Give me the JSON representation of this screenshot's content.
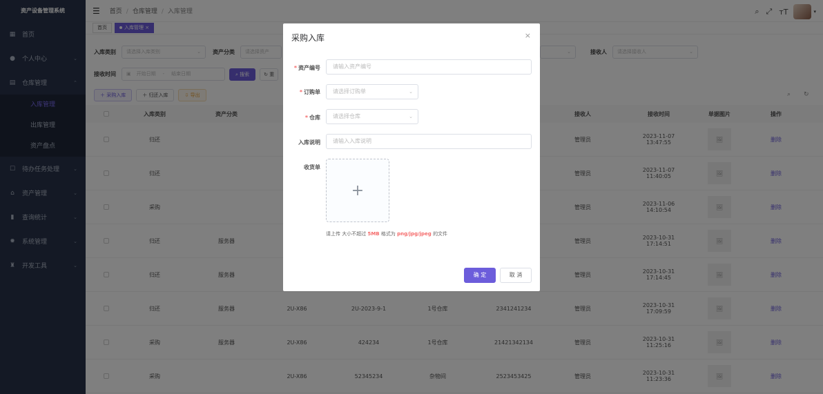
{
  "sidebar": {
    "logo": "资产设备管理系统",
    "items": [
      {
        "label": "首页",
        "icon": "dashboard-icon"
      },
      {
        "label": "个人中心",
        "icon": "user-icon"
      },
      {
        "label": "仓库管理",
        "icon": "grid-icon"
      }
    ],
    "sub_items": [
      "入库管理",
      "出库管理",
      "资产盘点"
    ],
    "items_after": [
      {
        "label": "待办任务处理",
        "icon": "task-icon"
      },
      {
        "label": "资产管理",
        "icon": "home-icon"
      },
      {
        "label": "查询统计",
        "icon": "bar-chart-icon"
      },
      {
        "label": "系统管理",
        "icon": "gear-icon"
      },
      {
        "label": "开发工具",
        "icon": "tool-icon"
      }
    ]
  },
  "navbar": {
    "breadcrumb": [
      "首页",
      "仓库管理",
      "入库管理"
    ],
    "sep": "/"
  },
  "tags": {
    "home": "首页",
    "active": "入库管理",
    "close": "×"
  },
  "filters": {
    "in_type_label": "入库类别",
    "in_type_placeholder": "请选择入库类别",
    "asset_cat_label": "资产分类",
    "asset_cat_placeholder": "请选择资产",
    "receiver_label": "接收人",
    "receiver_placeholder": "请选择接收人",
    "recv_time_label": "接收时间",
    "start_placeholder": "开始日期",
    "dash": "-",
    "end_placeholder": "结束日期",
    "search_btn": "搜索",
    "reset_btn": "重"
  },
  "toolbar": {
    "purchase_in": "采购入库",
    "return_in": "归还入库",
    "export": "导出"
  },
  "table": {
    "headers": {
      "type": "入库类别",
      "cat": "资产分类",
      "receiver": "接收人",
      "time": "接收时间",
      "image": "单据图片",
      "ops": "操作"
    },
    "delete_label": "删除",
    "rows": [
      {
        "type": "归还",
        "cat": "",
        "model": "",
        "code": "",
        "wh": "",
        "order": "",
        "receiver": "管理员",
        "time": "2023-11-07 13:47:55"
      },
      {
        "type": "归还",
        "cat": "",
        "model": "",
        "code": "",
        "wh": "",
        "order": "",
        "receiver": "管理员",
        "time": "2023-11-07 11:40:05"
      },
      {
        "type": "采购",
        "cat": "",
        "model": "",
        "code": "",
        "wh": "",
        "order": "",
        "receiver": "管理员",
        "time": "2023-11-06 14:10:54"
      },
      {
        "type": "归还",
        "cat": "服务器",
        "model": "",
        "code": "",
        "wh": "",
        "order": "",
        "receiver": "管理员",
        "time": "2023-10-31 17:14:51"
      },
      {
        "type": "归还",
        "cat": "服务器",
        "model": "",
        "code": "",
        "wh": "",
        "order": "",
        "receiver": "管理员",
        "time": "2023-10-31 17:14:45"
      },
      {
        "type": "归还",
        "cat": "服务器",
        "model": "2U-X86",
        "code": "2U-2023-9-1",
        "wh": "1号仓库",
        "order": "2341241234",
        "receiver": "管理员",
        "time": "2023-10-31 17:09:59"
      },
      {
        "type": "采购",
        "cat": "服务器",
        "model": "2U-X86",
        "code": "424234",
        "wh": "1号仓库",
        "order": "21421342134",
        "receiver": "管理员",
        "time": "2023-10-31 11:25:16"
      },
      {
        "type": "采购",
        "cat": "",
        "model": "2U-X86",
        "code": "52345234",
        "wh": "杂物间",
        "order": "2523453425",
        "receiver": "管理员",
        "time": "2023-10-31 11:23:36"
      }
    ]
  },
  "modal": {
    "title": "采购入库",
    "close": "×",
    "required_mark": "*",
    "asset_no_label": "资产编号",
    "asset_no_placeholder": "请输入资产编号",
    "order_label": "订购单",
    "order_placeholder": "请选择订购单",
    "wh_label": "仓库",
    "wh_placeholder": "请选择仓库",
    "desc_label": "入库说明",
    "desc_placeholder": "请输入入库说明",
    "receipt_label": "收货单",
    "upload_plus": "+",
    "tip_prefix": "请上传 大小不超过",
    "tip_size": "5MB",
    "tip_mid": "格式为",
    "tip_formats": "png/jpg/jpeg",
    "tip_suffix": "的文件",
    "confirm": "确 定",
    "cancel": "取 消"
  },
  "colors": {
    "accent": "#6c5ddb",
    "sidebar": "#28334a",
    "required": "#f56c6c"
  }
}
